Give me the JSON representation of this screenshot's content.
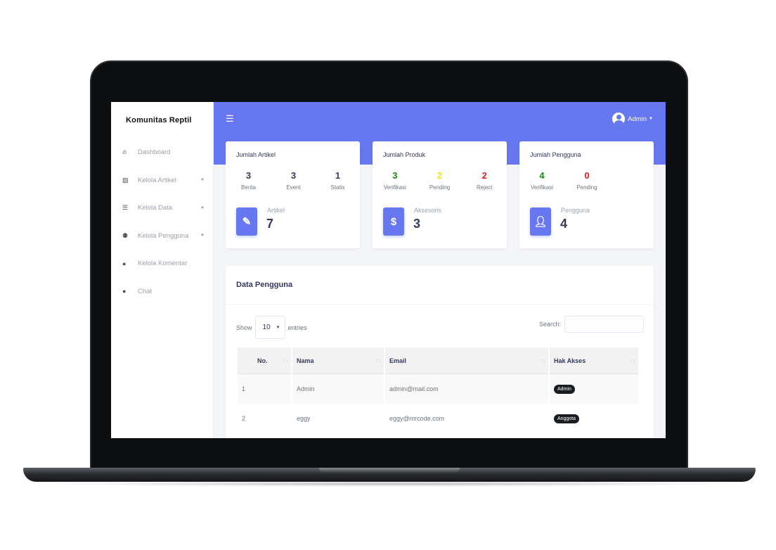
{
  "app": {
    "brand": "Komunitas  Reptil"
  },
  "topbar": {
    "menu_icon": "hamburger-icon",
    "user_name": "Admin"
  },
  "sidebar": {
    "items": [
      {
        "label": "Dashboard",
        "icon": "fire-icon",
        "has_caret": false
      },
      {
        "label": "Kelola Artikel",
        "icon": "edit-icon",
        "has_caret": true
      },
      {
        "label": "Kelola Data",
        "icon": "list-icon",
        "has_caret": true
      },
      {
        "label": "Kelola Pengguna",
        "icon": "users-icon",
        "has_caret": true
      },
      {
        "label": "Kelola Komentar",
        "icon": "comments-icon",
        "has_caret": false
      },
      {
        "label": "Chat",
        "icon": "comments-icon",
        "has_caret": false
      }
    ]
  },
  "cards": {
    "artikel": {
      "title": "Jumlah Artikel",
      "stats": [
        {
          "value": "3",
          "label": "Berita",
          "color": "#34395e"
        },
        {
          "value": "3",
          "label": "Event",
          "color": "#34395e"
        },
        {
          "value": "1",
          "label": "Statis",
          "color": "#34395e"
        }
      ],
      "icon": "pencil-icon",
      "total_label": "Artikel",
      "total_value": "7"
    },
    "produk": {
      "title": "Jumlah Produk",
      "stats": [
        {
          "value": "3",
          "label": "Verifikasi",
          "color": "#1a8a1a"
        },
        {
          "value": "2",
          "label": "Pending",
          "color": "#f5e30a"
        },
        {
          "value": "2",
          "label": "Reject",
          "color": "#e11d1d"
        }
      ],
      "icon": "dollar-icon",
      "total_label": "Aksesoris",
      "total_value": "3"
    },
    "pengguna": {
      "title": "Jumlah Pengguna",
      "stats": [
        {
          "value": "4",
          "label": "Verifikasi",
          "color": "#1a8a1a"
        },
        {
          "value": "0",
          "label": "Pending",
          "color": "#e11d1d"
        }
      ],
      "icon": "user-icon",
      "total_label": "Pengguna",
      "total_value": "4"
    }
  },
  "table": {
    "title": "Data Pengguna",
    "show_label": "Show",
    "entries_value": "10",
    "entries_label": "entries",
    "search_label": "Search:",
    "columns": [
      "No.",
      "Nama",
      "Email",
      "Hak Akses"
    ],
    "rows": [
      {
        "no": "1",
        "nama": "Admin",
        "email": "admin@mail.com",
        "hak_akses": "Admin"
      },
      {
        "no": "2",
        "nama": "eggy",
        "email": "eggy@mrcode.com",
        "hak_akses": "Anggota"
      }
    ]
  },
  "colors": {
    "primary": "#6777ef",
    "badge": "#191d21"
  }
}
